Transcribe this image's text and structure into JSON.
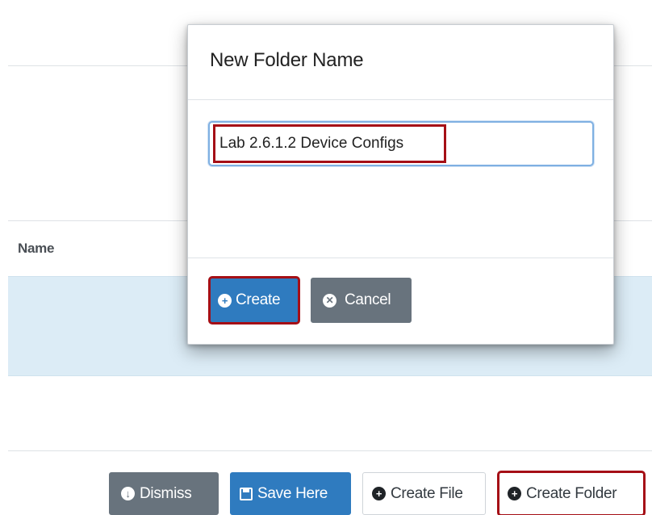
{
  "table": {
    "name_header": "Name"
  },
  "footer": {
    "dismiss_label": "Dismiss",
    "save_here_label": "Save Here",
    "create_file_label": "Create File",
    "create_folder_label": "Create Folder"
  },
  "modal": {
    "title": "New Folder Name",
    "folder_name_value": "Lab 2.6.1.2 Device Configs",
    "create_label": "Create",
    "cancel_label": "Cancel"
  },
  "icons": {
    "dismiss": "arrow-circle-down-icon",
    "save": "floppy-disk-icon",
    "create_file": "plus-circle-icon",
    "create_folder": "plus-circle-icon",
    "create": "plus-circle-icon",
    "cancel": "x-circle-icon"
  },
  "colors": {
    "primary": "#2f7bbf",
    "secondary": "#68737d",
    "highlight": "#a50f16",
    "selected_row": "#dcecf6"
  }
}
